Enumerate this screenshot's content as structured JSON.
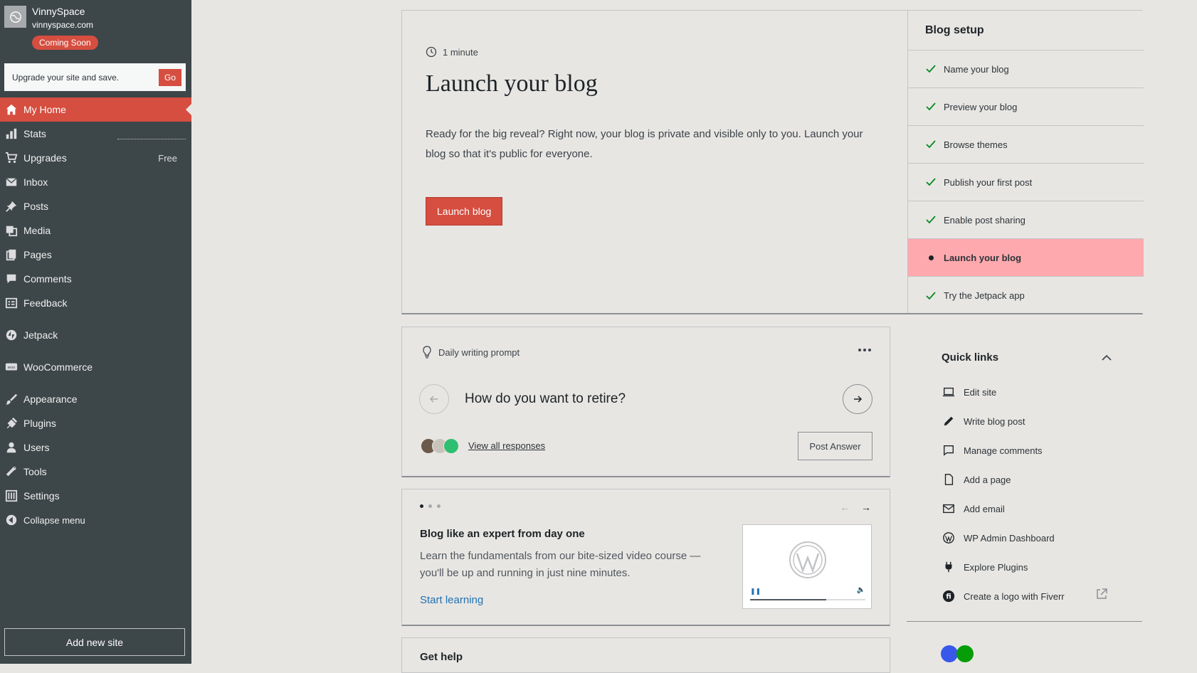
{
  "sidebar": {
    "site_name": "VinnySpace",
    "site_url": "vinnyspace.com",
    "status_badge": "Coming Soon",
    "upgrade_text": "Upgrade your site and save.",
    "upgrade_button": "Go",
    "items": [
      {
        "label": "My Home",
        "icon": "home-icon"
      },
      {
        "label": "Stats",
        "icon": "stats-icon"
      },
      {
        "label": "Upgrades",
        "icon": "cart-icon",
        "badge": "Free"
      },
      {
        "label": "Inbox",
        "icon": "mail-icon"
      },
      {
        "label": "Posts",
        "icon": "pin-icon"
      },
      {
        "label": "Media",
        "icon": "media-icon"
      },
      {
        "label": "Pages",
        "icon": "pages-icon"
      },
      {
        "label": "Comments",
        "icon": "comment-icon"
      },
      {
        "label": "Feedback",
        "icon": "feedback-icon"
      },
      {
        "label": "Jetpack",
        "icon": "jetpack-icon"
      },
      {
        "label": "WooCommerce",
        "icon": "woo-icon"
      },
      {
        "label": "Appearance",
        "icon": "brush-icon"
      },
      {
        "label": "Plugins",
        "icon": "plug-icon"
      },
      {
        "label": "Users",
        "icon": "user-icon"
      },
      {
        "label": "Tools",
        "icon": "wrench-icon"
      },
      {
        "label": "Settings",
        "icon": "settings-icon"
      },
      {
        "label": "Collapse menu",
        "icon": "collapse-icon"
      }
    ],
    "add_site": "Add new site"
  },
  "launch": {
    "time": "1 minute",
    "title": "Launch your blog",
    "description": "Ready for the big reveal? Right now, your blog is private and visible only to you. Launch your blog so that it's public for everyone.",
    "button": "Launch blog"
  },
  "setup": {
    "title": "Blog setup",
    "tasks": [
      {
        "label": "Name your blog",
        "done": true
      },
      {
        "label": "Preview your blog",
        "done": true
      },
      {
        "label": "Browse themes",
        "done": true
      },
      {
        "label": "Publish your first post",
        "done": true
      },
      {
        "label": "Enable post sharing",
        "done": true
      },
      {
        "label": "Launch your blog",
        "done": false,
        "current": true
      },
      {
        "label": "Try the Jetpack app",
        "done": true
      }
    ]
  },
  "prompt": {
    "heading": "Daily writing prompt",
    "question": "How do you want to retire?",
    "view_all": "View all responses",
    "post_answer": "Post Answer"
  },
  "learn": {
    "title": "Blog like an expert from day one",
    "description": "Learn the fundamentals from our bite-sized video course — you'll be up and running in just nine minutes.",
    "link": "Start learning",
    "video_progress": 0.66
  },
  "help": {
    "title": "Get help"
  },
  "quick_links": {
    "title": "Quick links",
    "items": [
      {
        "label": "Edit site",
        "icon": "laptop-icon"
      },
      {
        "label": "Write blog post",
        "icon": "pencil-icon"
      },
      {
        "label": "Manage comments",
        "icon": "comment-icon"
      },
      {
        "label": "Add a page",
        "icon": "page-icon"
      },
      {
        "label": "Add email",
        "icon": "mail-icon"
      },
      {
        "label": "WP Admin Dashboard",
        "icon": "wordpress-icon"
      },
      {
        "label": "Explore Plugins",
        "icon": "plug-icon"
      },
      {
        "label": "Create a logo with Fiverr",
        "icon": "fiverr-icon"
      }
    ]
  },
  "colors": {
    "accent": "#d54e40",
    "sidebar": "#3d4649",
    "highlight": "#fda9ae",
    "check": "#008a20"
  }
}
